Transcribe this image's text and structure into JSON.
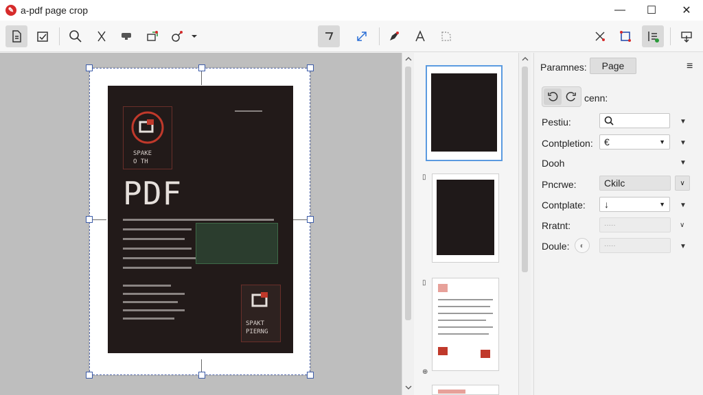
{
  "window": {
    "title": "a-pdf page crop",
    "logo_icon": "a-pdf-logo-icon",
    "controls": {
      "minimize": "—",
      "maximize": "☐",
      "close": "✕"
    }
  },
  "toolbar": {
    "buttons": [
      {
        "icon": "page-properties-icon"
      },
      {
        "icon": "checkbox-form-icon"
      },
      {
        "icon": "search-icon"
      },
      {
        "icon": "cut-icon"
      },
      {
        "icon": "stamp-icon"
      },
      {
        "icon": "export-icon"
      },
      {
        "icon": "tools-icon"
      },
      {
        "icon": "dropdown-icon"
      },
      {
        "icon": "crop-tool-icon",
        "active": true
      },
      {
        "icon": "resize-icon"
      },
      {
        "icon": "pen-icon"
      },
      {
        "icon": "text-icon"
      },
      {
        "icon": "select-region-icon"
      },
      {
        "icon": "arrange-icon"
      },
      {
        "icon": "crop-frame-icon"
      },
      {
        "icon": "layers-icon"
      },
      {
        "icon": "download-icon"
      }
    ]
  },
  "document": {
    "poster_title": "PDF",
    "poster_logo_caption": "SPAKE\nO TH",
    "poster_bottom_caption": "SPAKT\nPIERNG"
  },
  "thumbnails": {
    "page_markers": [
      "▯",
      "▯",
      "⊕"
    ],
    "selected_index": 0
  },
  "params": {
    "title": "Paramnes:",
    "tab_label": "Page",
    "rotate_label": "cenn:",
    "rows": [
      {
        "label": "Pestiu:",
        "value": "🔍",
        "control": "search-field"
      },
      {
        "label": "Contpletion:",
        "value": "€",
        "control": "select"
      },
      {
        "label": "Dooh",
        "value": "",
        "control": "dropdown"
      },
      {
        "label": "Pncrwe:",
        "value": "Ckilc",
        "control": "grey-field"
      },
      {
        "label": "Contplate:",
        "value": "↓",
        "control": "select"
      },
      {
        "label": "Rratnt:",
        "value": "·····",
        "control": "disabled-field"
      },
      {
        "label": "Doule:",
        "value": "·····",
        "control": "disabled-field"
      }
    ]
  },
  "colors": {
    "accent": "#3b5ba8",
    "poster_bg": "#221a19",
    "poster_red": "#c0392b",
    "selected_thumb": "#5a9ae0"
  }
}
